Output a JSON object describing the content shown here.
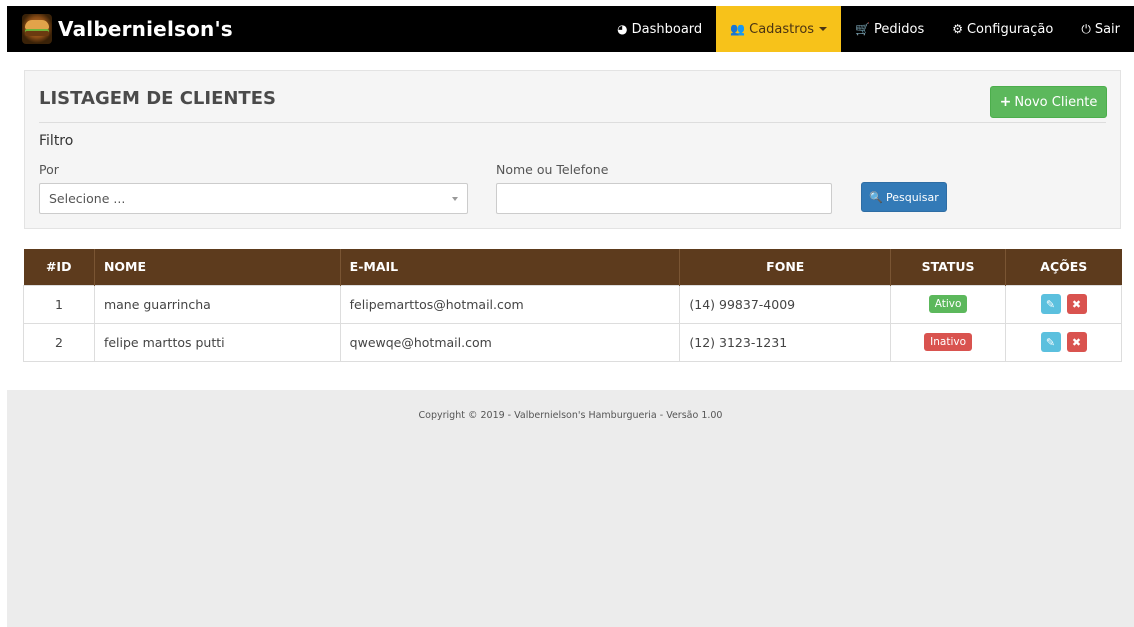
{
  "brand": {
    "name": "Valbernielson's"
  },
  "nav": {
    "items": [
      {
        "label": "Dashboard",
        "icon": "dashboard-icon",
        "glyph": "◕"
      },
      {
        "label": "Cadastros",
        "icon": "users-add-icon",
        "glyph": "👥",
        "active": true
      },
      {
        "label": "Pedidos",
        "icon": "cart-icon",
        "glyph": "🛒"
      },
      {
        "label": "Configuração",
        "icon": "gear-icon",
        "glyph": "⚙"
      },
      {
        "label": "Sair",
        "icon": "power-icon",
        "glyph": "⏻"
      }
    ]
  },
  "panel": {
    "title": "LISTAGEM DE CLIENTES",
    "new_button": "Novo Cliente",
    "filter_title": "Filtro",
    "por_label": "Por",
    "select_value": "Selecione ...",
    "nome_label": "Nome ou Telefone",
    "nome_value": "",
    "search_button": "Pesquisar"
  },
  "table": {
    "headers": [
      "#ID",
      "NOME",
      "E-MAIL",
      "FONE",
      "STATUS",
      "AÇÕES"
    ],
    "rows": [
      {
        "id": "1",
        "nome": "mane guarrincha",
        "email": "felipemarttos@hotmail.com",
        "fone": "(14) 99837-4009",
        "status": "Ativo"
      },
      {
        "id": "2",
        "nome": "felipe marttos putti",
        "email": "qwewqe@hotmail.com",
        "fone": "(12) 3123-1231",
        "status": "Inativo"
      }
    ]
  },
  "footer": {
    "text": "Copyright © 2019 - Valbernielson's Hamburgueria - Versão 1.00"
  },
  "colors": {
    "navbar": "#000000",
    "active": "#f7c21a",
    "table_header": "#5d3b1d",
    "success": "#5cb85c",
    "danger": "#d9534f",
    "primary": "#337ab7",
    "info": "#5bc0de"
  }
}
